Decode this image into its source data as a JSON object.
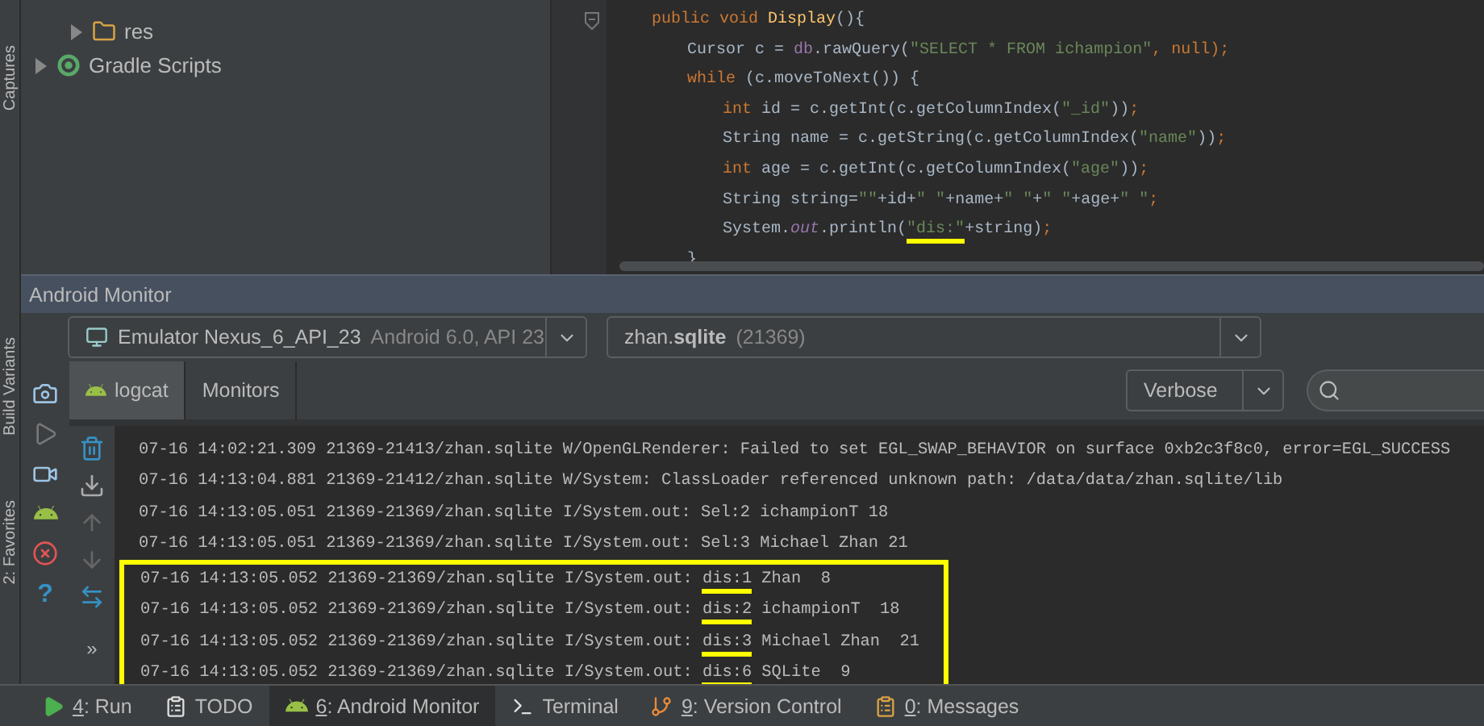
{
  "left_stripe": {
    "tabs": [
      "Captures",
      "Build Variants",
      "2: Favorites"
    ],
    "help_glyph": "?"
  },
  "project_tree": {
    "items": [
      {
        "label": "res",
        "kind": "folder",
        "expanded": false
      },
      {
        "label": "Gradle Scripts",
        "kind": "gradle",
        "expanded": false
      }
    ]
  },
  "editor": {
    "lines": [
      {
        "tokens": [
          {
            "text": "public void ",
            "kind": "keyword"
          },
          {
            "text": "Display",
            "kind": "method"
          },
          {
            "text": "(){",
            "kind": "plain"
          }
        ],
        "children": [
          {
            "tokens": [
              {
                "text": "Cursor c = ",
                "kind": "plain"
              },
              {
                "text": "db",
                "kind": "field"
              },
              {
                "text": ".rawQuery(",
                "kind": "plain"
              },
              {
                "text": "\"SELECT * FROM ichampion\"",
                "kind": "string"
              },
              {
                "text": ", ",
                "kind": "keyword"
              },
              {
                "text": "null",
                "kind": "keyword"
              },
              {
                "text": ");",
                "kind": "keyword"
              }
            ]
          },
          {
            "tokens": [
              {
                "text": "while ",
                "kind": "keyword"
              },
              {
                "text": "(c.moveToNext()) {",
                "kind": "plain"
              }
            ],
            "children": [
              {
                "tokens": [
                  {
                    "text": "int ",
                    "kind": "keyword"
                  },
                  {
                    "text": "id = c.getInt(c.getColumnIndex(",
                    "kind": "plain"
                  },
                  {
                    "text": "\"_id\"",
                    "kind": "string"
                  },
                  {
                    "text": "))",
                    "kind": "plain"
                  },
                  {
                    "text": ";",
                    "kind": "keyword"
                  }
                ]
              },
              {
                "tokens": [
                  {
                    "text": "String name = c.getString(c.getColumnIndex(",
                    "kind": "plain"
                  },
                  {
                    "text": "\"name\"",
                    "kind": "string"
                  },
                  {
                    "text": "))",
                    "kind": "plain"
                  },
                  {
                    "text": ";",
                    "kind": "keyword"
                  }
                ]
              },
              {
                "tokens": [
                  {
                    "text": "int ",
                    "kind": "keyword"
                  },
                  {
                    "text": "age = c.getInt(c.getColumnIndex(",
                    "kind": "plain"
                  },
                  {
                    "text": "\"age\"",
                    "kind": "string"
                  },
                  {
                    "text": "))",
                    "kind": "plain"
                  },
                  {
                    "text": ";",
                    "kind": "keyword"
                  }
                ]
              },
              {
                "tokens": [
                  {
                    "text": "String string=",
                    "kind": "plain"
                  },
                  {
                    "text": "\"\"",
                    "kind": "string"
                  },
                  {
                    "text": "+id+",
                    "kind": "plain"
                  },
                  {
                    "text": "\" \"",
                    "kind": "string"
                  },
                  {
                    "text": "+name+",
                    "kind": "plain"
                  },
                  {
                    "text": "\" \"",
                    "kind": "string"
                  },
                  {
                    "text": "+",
                    "kind": "plain"
                  },
                  {
                    "text": "\" \"",
                    "kind": "string"
                  },
                  {
                    "text": "+age+",
                    "kind": "plain"
                  },
                  {
                    "text": "\" \"",
                    "kind": "string"
                  },
                  {
                    "text": ";",
                    "kind": "keyword"
                  }
                ]
              },
              {
                "tokens": [
                  {
                    "text": "System.",
                    "kind": "plain"
                  },
                  {
                    "text": "out",
                    "kind": "static"
                  },
                  {
                    "text": ".println(",
                    "kind": "plain"
                  },
                  {
                    "text": "\"dis:\"",
                    "kind": "string",
                    "underlined": true
                  },
                  {
                    "text": "+string)",
                    "kind": "plain"
                  },
                  {
                    "text": ";",
                    "kind": "keyword"
                  }
                ]
              }
            ]
          },
          {
            "tokens": [
              {
                "text": "}",
                "kind": "plain"
              }
            ]
          }
        ]
      }
    ]
  },
  "monitor": {
    "title": "Android Monitor",
    "device": {
      "name": "Emulator Nexus_6_API_23",
      "detail": "Android 6.0, API 23"
    },
    "process": {
      "name": "zhan.**sqlite**",
      "detail": "(21369)"
    },
    "tabs": [
      {
        "label": "logcat",
        "selected": true
      },
      {
        "label": "Monitors",
        "selected": false
      }
    ],
    "level": "Verbose",
    "log_lines": [
      {
        "highlighted": false,
        "segments": [
          {
            "text": "07-16 14:02:21.309 21369-21413/zhan.sqlite W/OpenGLRenderer: Failed to set EGL_SWAP_BEHAVIOR on surface 0xb2c3f8c0, error=EGL_SUCCESS"
          }
        ]
      },
      {
        "highlighted": false,
        "segments": [
          {
            "text": "07-16 14:13:04.881 21369-21412/zhan.sqlite W/System: ClassLoader referenced unknown path: /data/data/zhan.sqlite/lib"
          }
        ]
      },
      {
        "highlighted": false,
        "segments": [
          {
            "text": "07-16 14:13:05.051 21369-21369/zhan.sqlite I/System.out: Sel:2 ichampionT 18"
          }
        ]
      },
      {
        "highlighted": false,
        "segments": [
          {
            "text": "07-16 14:13:05.051 21369-21369/zhan.sqlite I/System.out: Sel:3 Michael Zhan 21"
          }
        ]
      },
      {
        "highlighted": true,
        "segments": [
          {
            "text": "07-16 14:13:05.052 21369-21369/zhan.sqlite I/System.out: "
          },
          {
            "text": "dis:1",
            "underlined": true
          },
          {
            "text": " Zhan  8"
          }
        ]
      },
      {
        "highlighted": true,
        "segments": [
          {
            "text": "07-16 14:13:05.052 21369-21369/zhan.sqlite I/System.out: "
          },
          {
            "text": "dis:2",
            "underlined": true
          },
          {
            "text": " ichampionT  18"
          }
        ]
      },
      {
        "highlighted": true,
        "segments": [
          {
            "text": "07-16 14:13:05.052 21369-21369/zhan.sqlite I/System.out: "
          },
          {
            "text": "dis:3",
            "underlined": true
          },
          {
            "text": " Michael Zhan  21"
          }
        ]
      },
      {
        "highlighted": true,
        "segments": [
          {
            "text": "07-16 14:13:05.052 21369-21369/zhan.sqlite I/System.out: "
          },
          {
            "text": "dis:6",
            "underlined": true
          },
          {
            "text": " SQLite  9"
          }
        ]
      }
    ],
    "toolbar_more": "»"
  },
  "bottom_bar": [
    {
      "kind": "run",
      "mnemonic": "4",
      "label": ": Run",
      "selected": false
    },
    {
      "kind": "todo",
      "label": "TODO",
      "selected": false
    },
    {
      "kind": "android",
      "mnemonic": "6",
      "label": ": Android Monitor",
      "selected": true
    },
    {
      "kind": "terminal",
      "label": "Terminal",
      "selected": false
    },
    {
      "kind": "vcs",
      "mnemonic": "9",
      "label": ": Version Control",
      "selected": false
    },
    {
      "kind": "messages",
      "mnemonic": "0",
      "label": ": Messages",
      "selected": false
    }
  ]
}
